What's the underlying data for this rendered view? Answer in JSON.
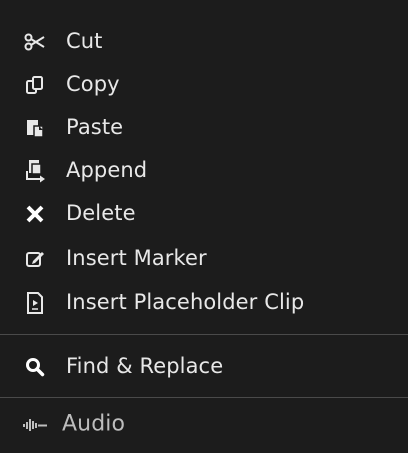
{
  "menu": {
    "items": [
      {
        "label": "Cut",
        "icon": "scissors-icon"
      },
      {
        "label": "Copy",
        "icon": "copy-icon"
      },
      {
        "label": "Paste",
        "icon": "paste-icon"
      },
      {
        "label": "Append",
        "icon": "append-icon"
      },
      {
        "label": "Delete",
        "icon": "x-icon"
      },
      {
        "label": "Insert Marker",
        "icon": "edit-marker-icon"
      },
      {
        "label": "Insert Placeholder Clip",
        "icon": "placeholder-clip-icon"
      },
      {
        "label": "Find & Replace",
        "icon": "search-icon"
      },
      {
        "label": "Audio",
        "icon": "audio-waveform-icon"
      }
    ]
  },
  "colors": {
    "background": "#1c1c1c",
    "text": "#e8e8e8",
    "separator": "#4a4a4a"
  }
}
